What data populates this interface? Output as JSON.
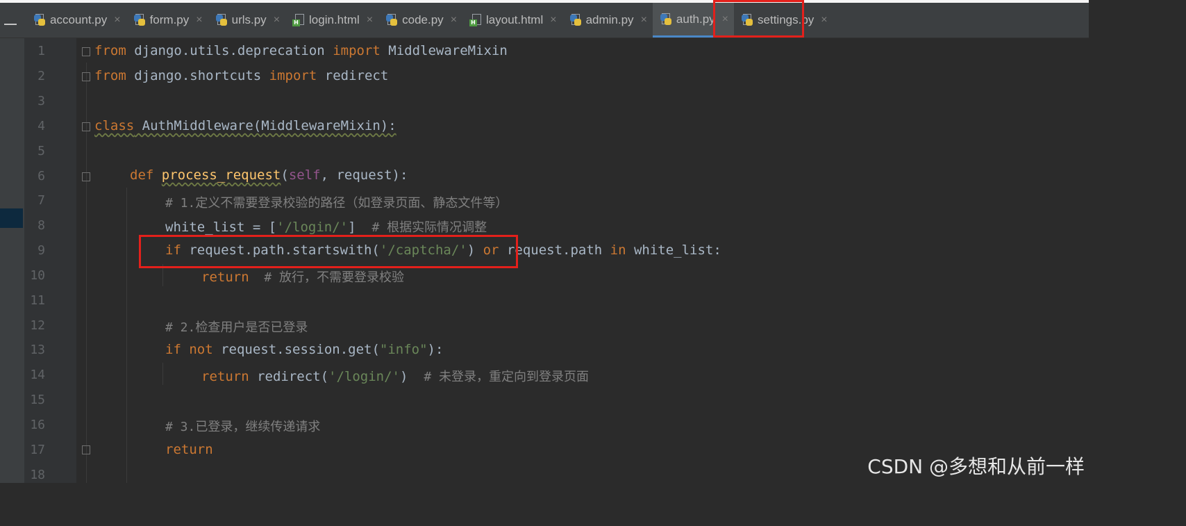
{
  "editor": {
    "tabs": [
      {
        "label": "account.py",
        "type": "py"
      },
      {
        "label": "form.py",
        "type": "py"
      },
      {
        "label": "urls.py",
        "type": "py"
      },
      {
        "label": "login.html",
        "type": "html"
      },
      {
        "label": "code.py",
        "type": "py"
      },
      {
        "label": "layout.html",
        "type": "html"
      },
      {
        "label": "admin.py",
        "type": "py"
      },
      {
        "label": "auth.py",
        "type": "py",
        "active": true
      },
      {
        "label": "settings.py",
        "type": "py"
      }
    ],
    "close_glyph": "×",
    "line_numbers": [
      "1",
      "2",
      "3",
      "4",
      "5",
      "6",
      "7",
      "8",
      "9",
      "10",
      "11",
      "12",
      "13",
      "14",
      "15",
      "16",
      "17",
      "18"
    ],
    "code": {
      "l1": {
        "k1": "from",
        "t1": " django.utils.deprecation ",
        "k2": "import",
        "t2": " MiddlewareMixin"
      },
      "l2": {
        "k1": "from",
        "t1": " django.shortcuts ",
        "k2": "import",
        "t2": " redirect"
      },
      "l4": {
        "k1": "class",
        "t1": " AuthMiddleware(MiddlewareMixin):"
      },
      "l6": {
        "k1": "def",
        "fn": "process_request",
        "p1": "(",
        "self": "self",
        "p2": ", request):"
      },
      "l7": {
        "c": "# 1.定义不需要登录校验的路径（如登录页面、静态文件等）"
      },
      "l8": {
        "t1": "white_list = [",
        "s1": "'/login/'",
        "t2": "]  ",
        "c": "# 根据实际情况调整"
      },
      "l9": {
        "k1": "if",
        "t1": " request.path.startswith(",
        "s1": "'/captcha/'",
        "t2": ") ",
        "k2": "or",
        "t3": " request.path ",
        "k3": "in",
        "t4": " white_list:"
      },
      "l10": {
        "k1": "return",
        "c": "  # 放行，不需要登录校验"
      },
      "l12": {
        "c": "# 2.检查用户是否已登录"
      },
      "l13": {
        "k1": "if",
        "t1": " ",
        "k2": "not",
        "t2": " request.session.get(",
        "s1": "\"info\"",
        "t3": "):"
      },
      "l14": {
        "k1": "return",
        "t1": " redirect(",
        "s1": "'/login/'",
        "t2": ")  ",
        "c": "# 未登录，重定向到登录页面"
      },
      "l16": {
        "c": "# 3.已登录，继续传递请求"
      },
      "l17": {
        "k1": "return"
      }
    }
  },
  "watermark": "CSDN @多想和从前一样",
  "colors": {
    "background": "#2b2b2b",
    "keyword": "#cc7832",
    "string": "#6a8759",
    "function": "#ffc66d",
    "comment": "#808080",
    "self": "#94558d",
    "highlight_box": "#e3201b"
  }
}
